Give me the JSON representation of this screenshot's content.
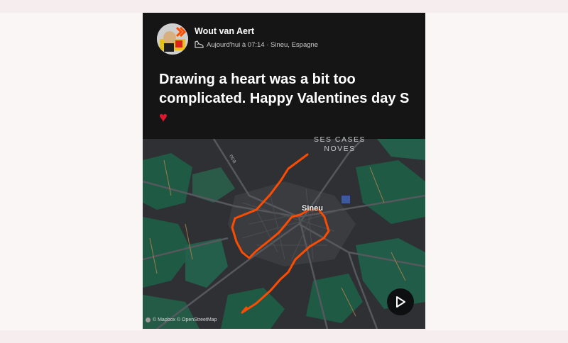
{
  "post": {
    "author": "Wout van Aert",
    "timestamp": "Aujourd'hui à 07:14 · Sineu, Espagne",
    "activity_icon": "shoe-icon",
    "text": "Drawing a heart was a bit too complicated. Happy Valentines day S",
    "emoji": "♥"
  },
  "map": {
    "town_label": "Sineu",
    "area_label_1": "SES CASES",
    "area_label_2": "NOVES",
    "road_label": "nca",
    "attribution": "© Mapbox © OpenStreetMap",
    "route_color": "#fc4c02",
    "play_icon": "play-icon"
  }
}
